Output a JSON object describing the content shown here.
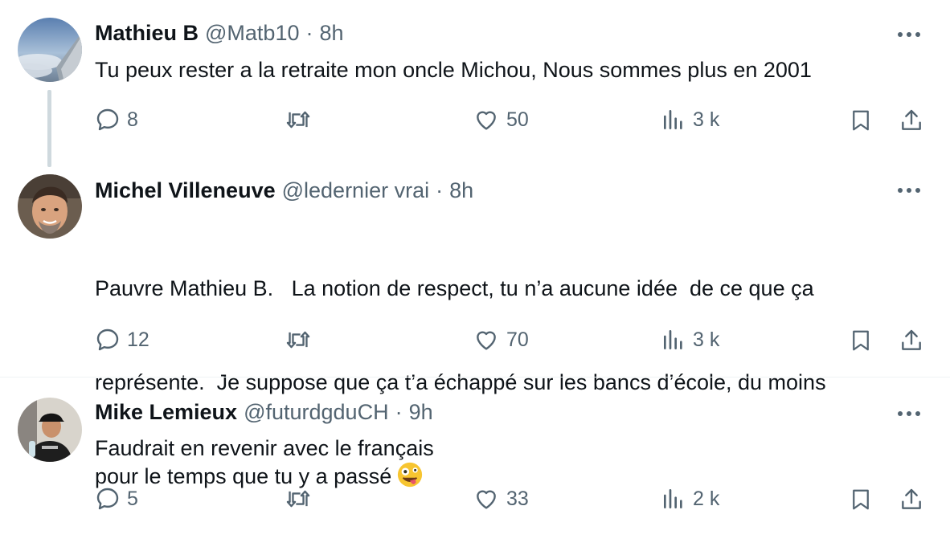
{
  "tweets": [
    {
      "name": "Mathieu B",
      "handle": "@Matb10",
      "separator": "·",
      "time": "8h",
      "text": "Tu peux rester a la retraite mon oncle Michou, Nous sommes plus en 2001",
      "replies": "8",
      "likes": "50",
      "views": "3 k"
    },
    {
      "name": "Michel Villeneuve",
      "handle": "@ledernier vrai",
      "separator": "·",
      "time": "8h",
      "text_lines": [
        "Pauvre Mathieu B.   La notion de respect, tu n’a aucune idée  de ce que ça",
        "représente.  Je suppose que ça t’a échappé sur les bancs d’école, du moins",
        "pour le temps que tu y a passé"
      ],
      "replies": "12",
      "likes": "70",
      "views": "3 k"
    },
    {
      "name": "Mike Lemieux",
      "handle": "@futurdgduCH",
      "separator": "·",
      "time": "9h",
      "text": "Faudrait en revenir avec le français",
      "replies": "5",
      "likes": "33",
      "views": "2 k"
    }
  ],
  "icons": {
    "reply": "reply-icon",
    "retweet": "retweet-icon",
    "like": "heart-icon",
    "views": "views-icon",
    "bookmark": "bookmark-icon",
    "share": "share-icon",
    "more": "more-icon",
    "emoji": "zany-face-emoji"
  },
  "colors": {
    "text": "#0f1419",
    "secondary": "#536471",
    "thread_line": "#cfd9de",
    "divider": "#eff3f4"
  }
}
